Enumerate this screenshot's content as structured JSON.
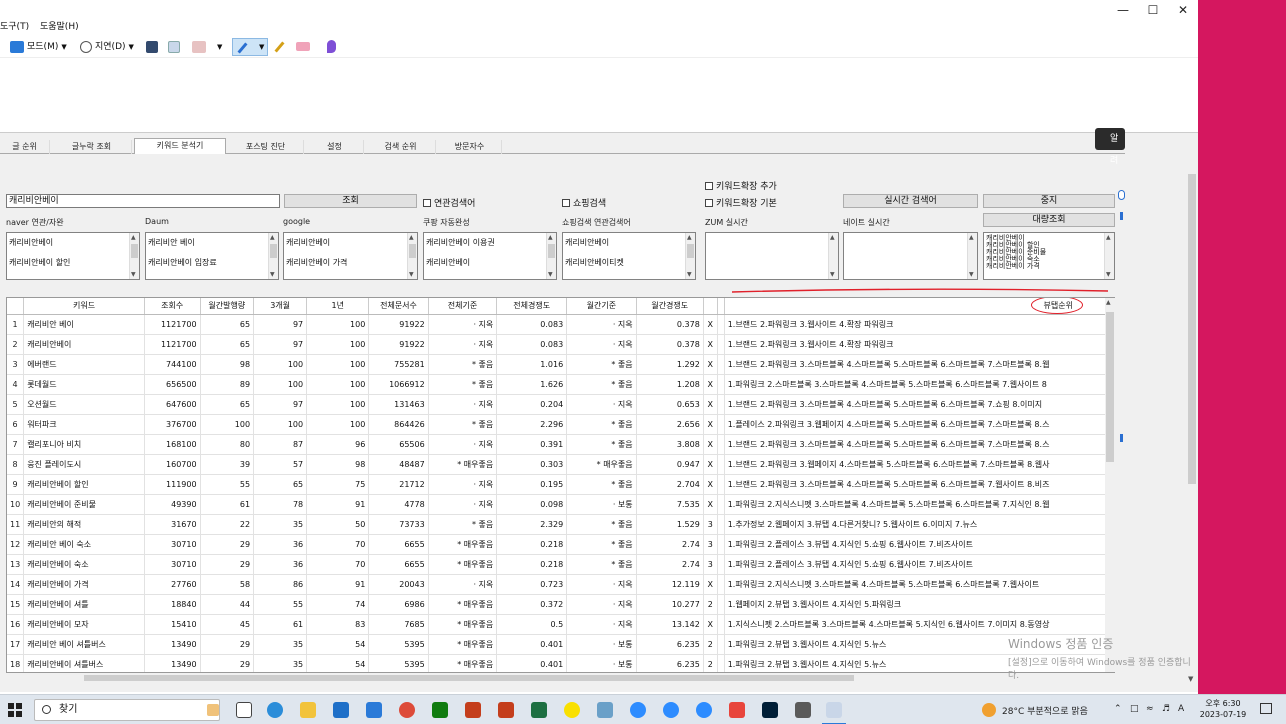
{
  "menu": [
    "도구(T)",
    "도움말(H)"
  ],
  "toolbar": {
    "mode_label": "모드(M)",
    "delay_label": "지연(D)"
  },
  "tabs": [
    "글 순위",
    "글누락 조회",
    "키워드 분석기",
    "포스팅 진단",
    "설정",
    "검색 순위",
    "방문자수"
  ],
  "tooltip_btn": "알려",
  "checks": {
    "related": "연관검색어",
    "shopping": "쇼핑검색",
    "kw_add": "키워드확장 추가",
    "kw_basic": "키워드확장 기본"
  },
  "buttons": {
    "search": "조회",
    "realtime": "실시간 검색어",
    "stop": "중지",
    "bulk": "대량조회"
  },
  "keyword": "캐리비안베이",
  "sections": [
    {
      "label": "naver 연관/자완",
      "items": [
        "캐리비안베이",
        "캐리비안베이 할인"
      ]
    },
    {
      "label": "Daum",
      "items": [
        "캐리비안 베이",
        "캐리비안베이 입장료"
      ]
    },
    {
      "label": "google",
      "items": [
        "캐리비안베이",
        "캐리비안베이 가격"
      ]
    },
    {
      "label": "쿠팡 자동완성",
      "items": [
        "캐리비안베이 이용권",
        "캐리비안베이"
      ]
    },
    {
      "label": "쇼핑검색 연관검색어",
      "items": [
        "캐리비안베이",
        "캐리비안베이티켓"
      ]
    },
    {
      "label": "ZUM 실시간",
      "items": []
    },
    {
      "label": "네이트 실시간",
      "items": []
    }
  ],
  "bulk_items": [
    "캐리비안베이",
    "캐리비안베이 할인",
    "캐리비안베이 준비물",
    "캐리비안베이 숙소",
    "캐리비안베이 가격"
  ],
  "grid": {
    "headers": [
      "",
      "키워드",
      "조회수",
      "월간발행량",
      "3개월",
      "1년",
      "전체문서수",
      "전체기준",
      "전체경쟁도",
      "월간기준",
      "월간경쟁도",
      "",
      "",
      "뷰탭순위"
    ],
    "rows": [
      [
        "1",
        "캐리비안 베이",
        "1121700",
        "65",
        "97",
        "100",
        "91922",
        "· 지옥",
        "0.083",
        "· 지옥",
        "0.378",
        "X",
        "",
        "1.브랜드  2.파워링크  3.웹사이트  4.확장 파워링크"
      ],
      [
        "2",
        "캐리비안베이",
        "1121700",
        "65",
        "97",
        "100",
        "91922",
        "· 지옥",
        "0.083",
        "· 지옥",
        "0.378",
        "X",
        "",
        "1.브랜드  2.파워링크  3.웹사이트  4.확장 파워링크"
      ],
      [
        "3",
        "에버랜드",
        "744100",
        "98",
        "100",
        "100",
        "755281",
        "* 좋음",
        "1.016",
        "* 좋음",
        "1.292",
        "X",
        "",
        "1.브랜드  2.파워링크  3.스마트블록  4.스마트블록  5.스마트블록  6.스마트블록  7.스마트블록  8.웹"
      ],
      [
        "4",
        "롯데월드",
        "656500",
        "89",
        "100",
        "100",
        "1066912",
        "* 좋음",
        "1.626",
        "* 좋음",
        "1.208",
        "X",
        "",
        "1.파워링크  2.스마트블록  3.스마트블록  4.스마트블록  5.스마트블록  6.스마트블록  7.웹사이트  8"
      ],
      [
        "5",
        "오션월드",
        "647600",
        "65",
        "97",
        "100",
        "131463",
        "· 지옥",
        "0.204",
        "· 지옥",
        "0.653",
        "X",
        "",
        "1.브랜드  2.파워링크  3.스마트블록  4.스마트블록  5.스마트블록  6.스마트블록  7.쇼핑  8.이미지"
      ],
      [
        "6",
        "워터파크",
        "376700",
        "100",
        "100",
        "100",
        "864426",
        "* 좋음",
        "2.296",
        "* 좋음",
        "2.656",
        "X",
        "",
        "1.플레이스  2.파워링크  3.웹페이지  4.스마트블록  5.스마트블록  6.스마트블록  7.스마트블록  8.스"
      ],
      [
        "7",
        "캘리포니아 비치",
        "168100",
        "80",
        "87",
        "96",
        "65506",
        "· 지옥",
        "0.391",
        "* 좋음",
        "3.808",
        "X",
        "",
        "1.브랜드  2.파워링크  3.스마트블록  4.스마트블록  5.스마트블록  6.스마트블록  7.스마트블록  8.스"
      ],
      [
        "8",
        "웅진 플레이도시",
        "160700",
        "39",
        "57",
        "98",
        "48487",
        "* 매우좋음",
        "0.303",
        "* 매우좋음",
        "0.947",
        "X",
        "",
        "1.브랜드  2.파워링크  3.웹페이지  4.스마트블록  5.스마트블록  6.스마트블록  7.스마트블록  8.웹사"
      ],
      [
        "9",
        "캐리비안베이 할인",
        "111900",
        "55",
        "65",
        "75",
        "21712",
        "· 지옥",
        "0.195",
        "* 좋음",
        "2.704",
        "X",
        "",
        "1.브랜드  2.파워링크  3.스마트블록  4.스마트블록  5.스마트블록  6.스마트블록  7.웹사이트  8.비즈"
      ],
      [
        "10",
        "캐리비안베이 준비물",
        "49390",
        "61",
        "78",
        "91",
        "4778",
        "· 지옥",
        "0.098",
        "· 보통",
        "7.535",
        "X",
        "",
        "1.파워링크  2.지식스니펫  3.스마트블록  4.스마트블록  5.스마트블록  6.스마트블록  7.지식인  8.웹"
      ],
      [
        "11",
        "캐리비안의 해적",
        "31670",
        "22",
        "35",
        "50",
        "73733",
        "* 좋음",
        "2.329",
        "* 좋음",
        "1.529",
        "3",
        "",
        "1.추가정보  2.웹페이지  3.뷰탭  4.다른거찾니?  5.웹사이트  6.이미지  7.뉴스"
      ],
      [
        "12",
        "캐리비안 베이 숙소",
        "30710",
        "29",
        "36",
        "70",
        "6655",
        "* 매우좋음",
        "0.218",
        "* 좋음",
        "2.74",
        "3",
        "",
        "1.파워링크  2.플레이스  3.뷰탭  4.지식인  5.쇼핑  6.웹사이트  7.비즈사이트"
      ],
      [
        "13",
        "캐리비안베이 숙소",
        "30710",
        "29",
        "36",
        "70",
        "6655",
        "* 매우좋음",
        "0.218",
        "* 좋음",
        "2.74",
        "3",
        "",
        "1.파워링크  2.플레이스  3.뷰탭  4.지식인  5.쇼핑  6.웹사이트  7.비즈사이트"
      ],
      [
        "14",
        "캐리비안베이 가격",
        "27760",
        "58",
        "86",
        "91",
        "20043",
        "· 지옥",
        "0.723",
        "· 지옥",
        "12.119",
        "X",
        "",
        "1.파워링크  2.지식스니펫  3.스마트블록  4.스마트블록  5.스마트블록  6.스마트블록  7.웹사이트"
      ],
      [
        "15",
        "캐리비안베이 셔틀",
        "18840",
        "44",
        "55",
        "74",
        "6986",
        "* 매우좋음",
        "0.372",
        "· 지옥",
        "10.277",
        "2",
        "",
        "1.웹페이지  2.뷰탭  3.웹사이트  4.지식인  5.파워링크"
      ],
      [
        "16",
        "캐리비안베이 모자",
        "15410",
        "45",
        "61",
        "83",
        "7685",
        "* 매우좋음",
        "0.5",
        "· 지옥",
        "13.142",
        "X",
        "",
        "1.지식스니펫  2.스마트블록  3.스마트블록  4.스마트블록  5.지식인  6.웹사이트  7.이미지  8.동영상"
      ],
      [
        "17",
        "캐리비안 베이 셔틀버스",
        "13490",
        "29",
        "35",
        "54",
        "5395",
        "* 매우좋음",
        "0.401",
        "· 보통",
        "6.235",
        "2",
        "",
        "1.파워링크  2.뷰탭  3.웹사이트  4.지식인  5.뉴스"
      ],
      [
        "18",
        "캐리비안베이 셔틀버스",
        "13490",
        "29",
        "35",
        "54",
        "5395",
        "* 매우좋음",
        "0.401",
        "· 보통",
        "6.235",
        "2",
        "",
        "1.파워링크  2.뷰탭  3.웹사이트  4.지식인  5.뉴스"
      ]
    ]
  },
  "watermark": {
    "title": "Windows 정품 인증",
    "sub": "[설정]으로 이동하여 Windows를 정품 인증합니다."
  },
  "taskbar": {
    "search_placeholder": "찾기",
    "weather": "28°C  부분적으로 맑음",
    "time": "오후 6:30",
    "date": "2023-07-19"
  },
  "colors": {
    "accent_pink": "#d5175f",
    "annotation_red": "#e0202a"
  }
}
